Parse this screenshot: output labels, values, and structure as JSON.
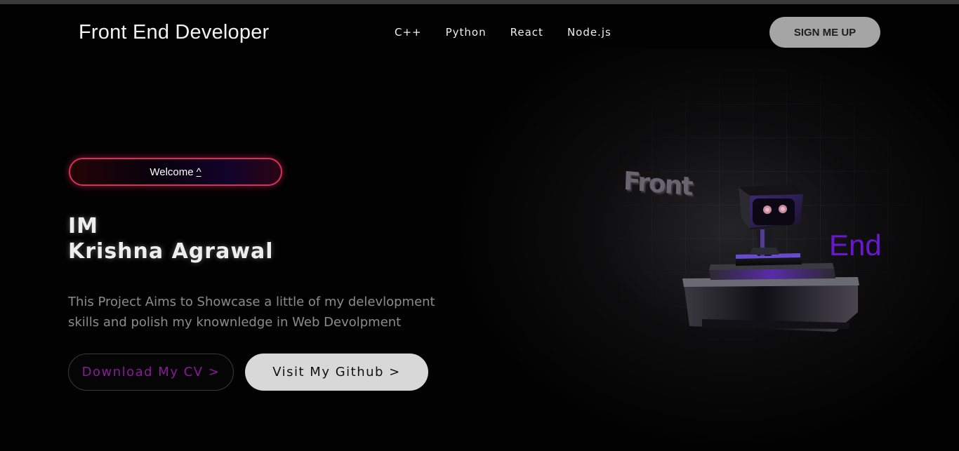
{
  "header": {
    "logo": "Front End Developer",
    "nav": [
      "C++",
      "Python",
      "React",
      "Node.js"
    ],
    "signup_label": "SIGN ME UP"
  },
  "hero": {
    "welcome_text": "Welcome",
    "welcome_caret": "^",
    "heading_line1": "IM",
    "heading_line2": "Krishna Agrawal",
    "description": "This Project Aims to Showcase a little of my delevlopment skills and polish my knownledge in Web Devolpment",
    "download_cv_label": "Download My CV >",
    "github_label": "Visit My Github >"
  },
  "scene": {
    "word_front": "Front",
    "word_end": "End",
    "accent_color": "#6a18d0",
    "robot_icon": "robot-icon"
  },
  "colors": {
    "background": "#020202",
    "welcome_border": "#d9305a",
    "cv_text": "#8a1a9a",
    "signup_bg": "#a5a5a5",
    "github_bg": "#d8d8d8"
  }
}
